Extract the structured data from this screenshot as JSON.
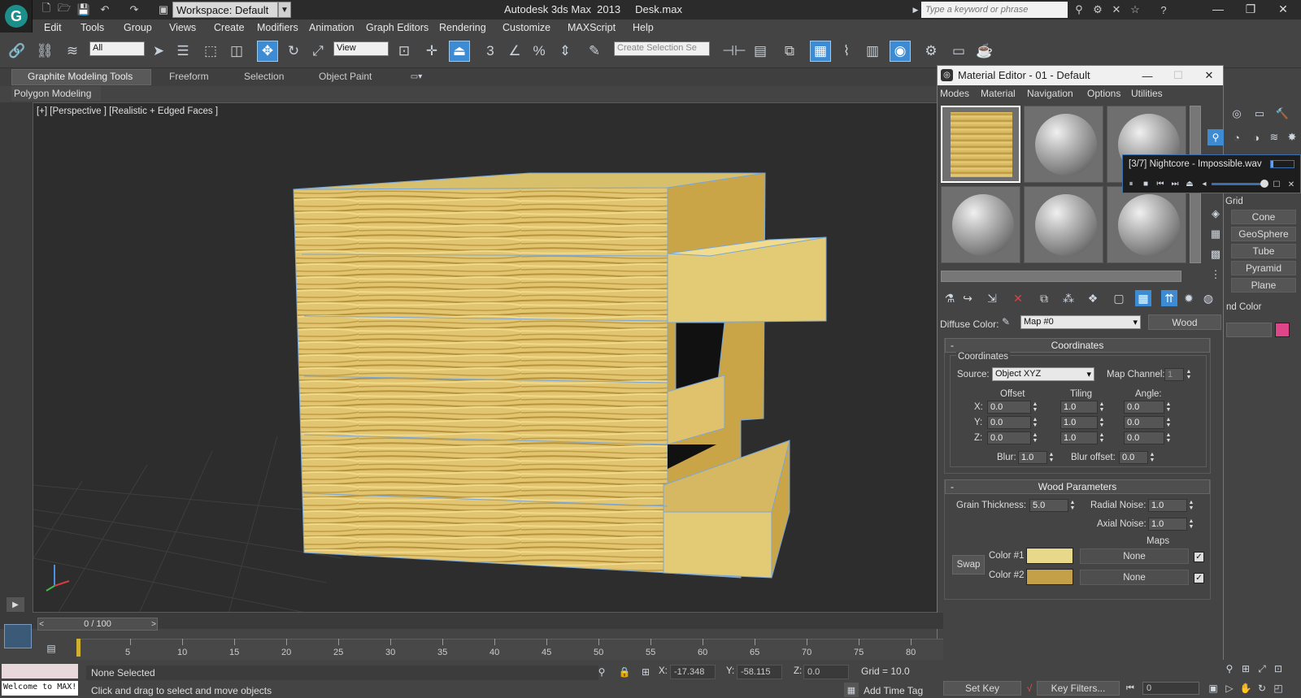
{
  "titlebar": {
    "workspace": "Workspace: Default",
    "app_name": "Autodesk 3ds Max  2013",
    "file_name": "Desk.max",
    "search_placeholder": "Type a keyword or phrase"
  },
  "menubar": [
    "Edit",
    "Tools",
    "Group",
    "Views",
    "Create",
    "Modifiers",
    "Animation",
    "Graph Editors",
    "Rendering",
    "Customize",
    "MAXScript",
    "Help"
  ],
  "toolbar": {
    "selection_filter": "All",
    "ref_coord": "View",
    "named_selection": "Create Selection Se"
  },
  "ribbon": {
    "tabs": [
      "Graphite Modeling Tools",
      "Freeform",
      "Selection",
      "Object Paint"
    ],
    "active_tab": "Graphite Modeling Tools",
    "subpanel": "Polygon Modeling"
  },
  "viewport": {
    "label": "[+] [Perspective ] [Realistic + Edged Faces ]",
    "colors": {
      "background": "#2d2d2d",
      "wood_light": "#e6cf7e",
      "wood_dark": "#b8913a",
      "edge": "#7aa7d8"
    }
  },
  "material_editor": {
    "title": "Material Editor - 01 - Default",
    "menus": [
      "Modes",
      "Material",
      "Navigation",
      "Options",
      "Utilities"
    ],
    "diffuse_label": "Diffuse Color:",
    "map_name": "Map #0",
    "map_type": "Wood",
    "coordinates": {
      "rollout_title": "Coordinates",
      "group_title": "Coordinates",
      "source_label": "Source:",
      "source": "Object XYZ",
      "map_channel_label": "Map Channel:",
      "map_channel": "1",
      "offset_label": "Offset",
      "tiling_label": "Tiling",
      "angle_label": "Angle:",
      "axes": [
        "X:",
        "Y:",
        "Z:"
      ],
      "offset": [
        "0.0",
        "0.0",
        "0.0"
      ],
      "tiling": [
        "1.0",
        "1.0",
        "1.0"
      ],
      "angle": [
        "0.0",
        "0.0",
        "0.0"
      ],
      "blur_label": "Blur:",
      "blur": "1.0",
      "blur_offset_label": "Blur offset:",
      "blur_offset": "0.0"
    },
    "wood": {
      "rollout_title": "Wood Parameters",
      "grain_label": "Grain Thickness:",
      "grain": "5.0",
      "radial_label": "Radial Noise:",
      "radial": "1.0",
      "axial_label": "Axial Noise:",
      "axial": "1.0",
      "maps_label": "Maps",
      "swap": "Swap",
      "color1_label": "Color #1",
      "color2_label": "Color #2",
      "color1": "#e8d88a",
      "color2": "#c4a048",
      "none": "None"
    }
  },
  "media_player": {
    "title": "[3/7] Nightcore - Impossible.wav"
  },
  "command_panel": {
    "buttons": [
      "Cone",
      "GeoSphere",
      "Tube",
      "Pyramid",
      "Plane"
    ],
    "grid_label": "Grid",
    "name_color_label": "nd Color",
    "name_color": "#e0458a"
  },
  "timeline": {
    "frame_display": "0 / 100",
    "ticks": [
      "5",
      "10",
      "15",
      "20",
      "25",
      "30",
      "35",
      "40",
      "45",
      "50",
      "55",
      "60",
      "65",
      "70",
      "75",
      "80"
    ]
  },
  "status": {
    "selection": "None Selected",
    "prompt": "Click and drag to select and move objects",
    "welcome": "Welcome to MAX!",
    "x_label": "X:",
    "x": "-17.348",
    "y_label": "Y:",
    "y": "-58.115",
    "z_label": "Z:",
    "z": "0.0",
    "grid": "Grid = 10.0",
    "add_time_tag": "Add Time Tag",
    "set_key": "Set Key",
    "key_filters": "Key Filters...",
    "frame": "0"
  }
}
